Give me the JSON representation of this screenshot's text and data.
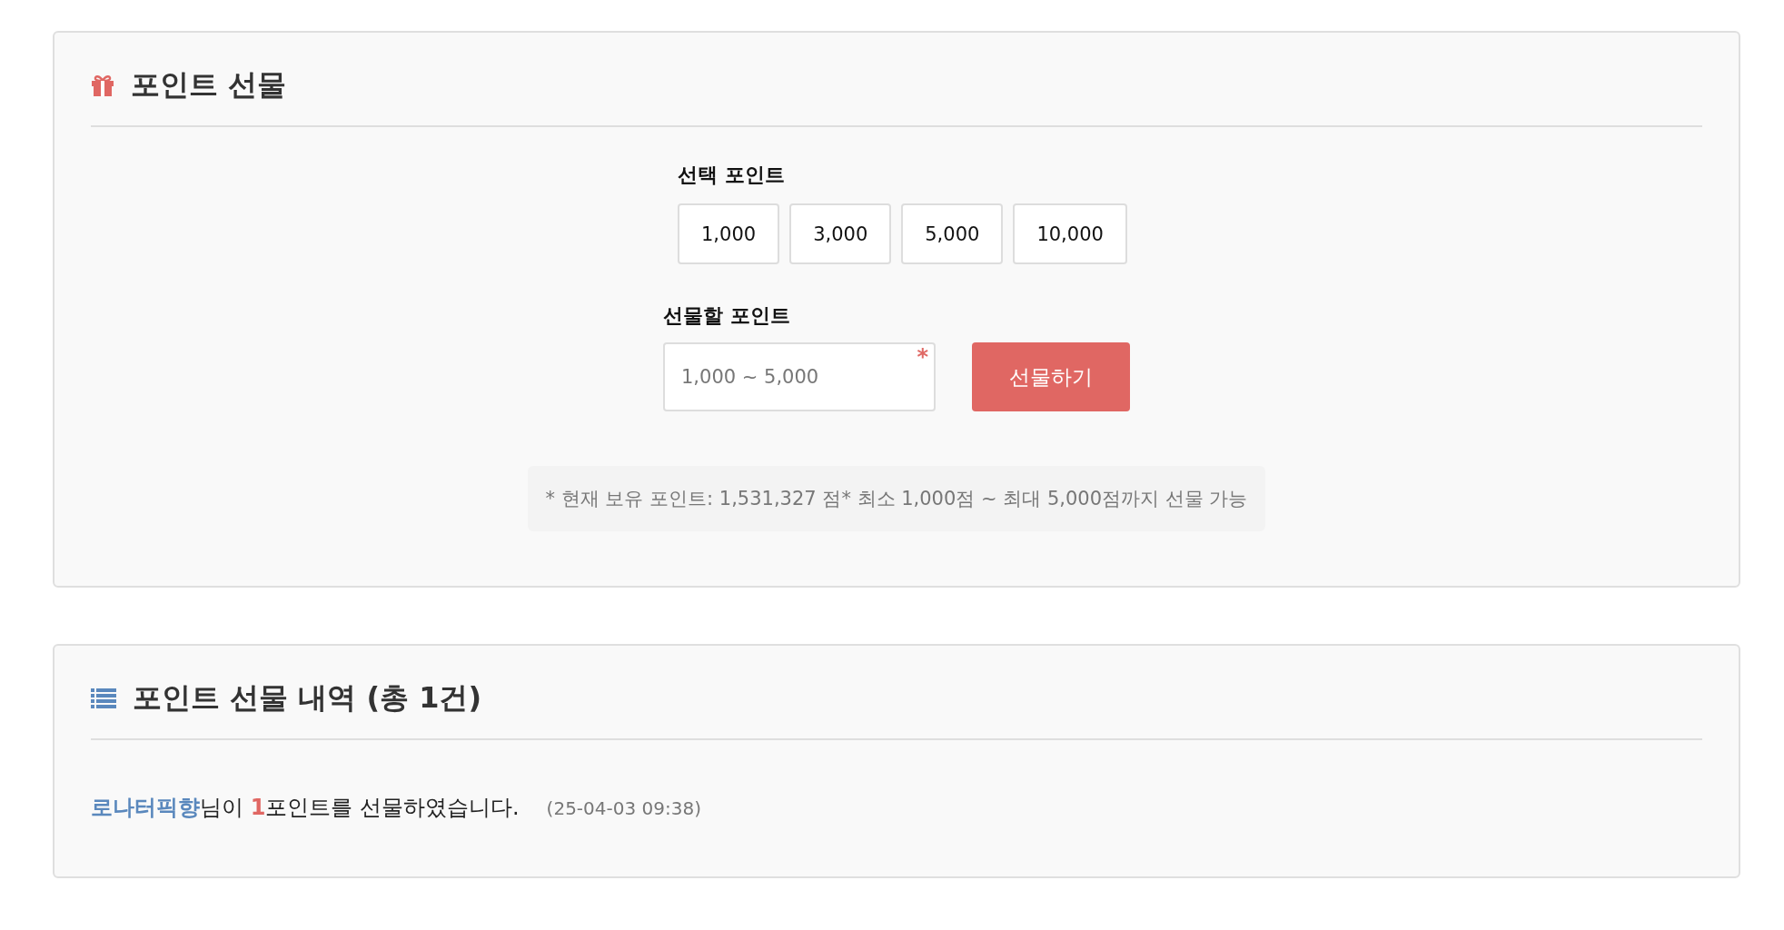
{
  "gift_panel": {
    "title": "포인트 선물",
    "preset_label": "선택 포인트",
    "presets": [
      {
        "label": "1,000"
      },
      {
        "label": "3,000"
      },
      {
        "label": "5,000"
      },
      {
        "label": "10,000"
      }
    ],
    "amount_label": "선물할 포인트",
    "amount_field": {
      "placeholder": "1,000 ~ 5,000",
      "required": true,
      "required_mark": "*"
    },
    "submit": "선물하기",
    "notice": "* 현재 보유 포인트: 1,531,327 점* 최소 1,000점 ~ 최대 5,000점까지 선물 가능"
  },
  "history_panel": {
    "title": "포인트 선물 내역 (총 1건)",
    "entries": [
      {
        "sender": "로나터픽향",
        "joiner": "님이 ",
        "amount": "1",
        "message": "포인트를 선물하였습니다.",
        "date": "(25-04-03 09:38)"
      }
    ]
  }
}
